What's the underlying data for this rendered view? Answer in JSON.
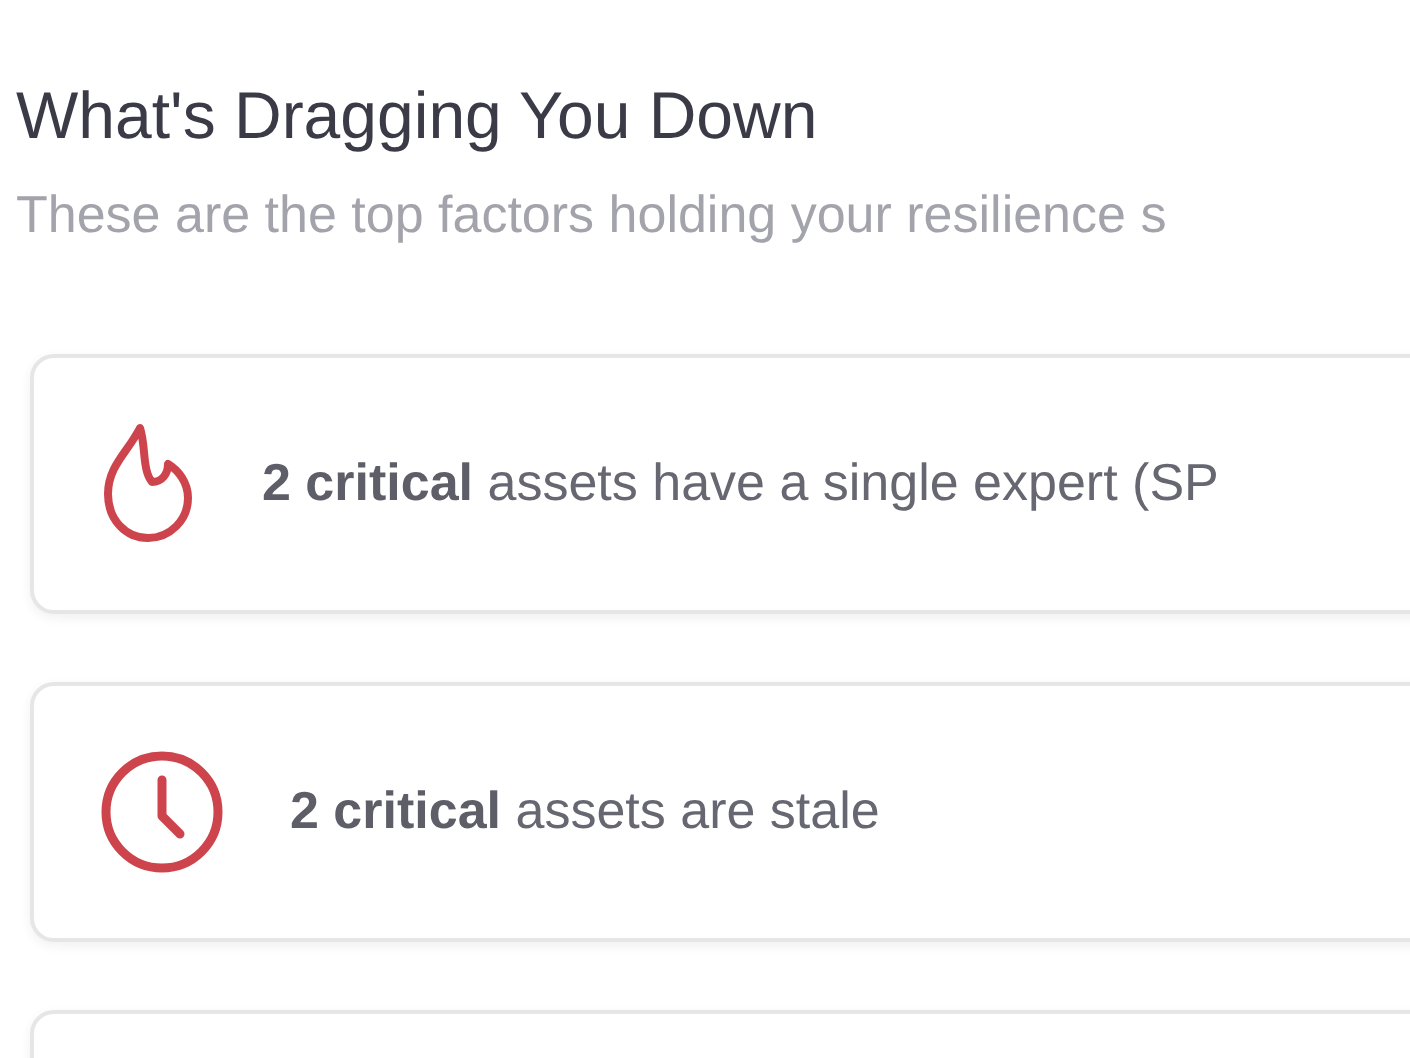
{
  "heading": "What's Dragging You Down",
  "subtitle": "These are the top factors holding your resilience s",
  "factors": [
    {
      "kind": "fire",
      "count": "2 critical",
      "text": " assets have a single expert (SP"
    },
    {
      "kind": "clock",
      "count": "2 critical",
      "text": " assets are stale"
    },
    {
      "kind": "empty"
    }
  ]
}
